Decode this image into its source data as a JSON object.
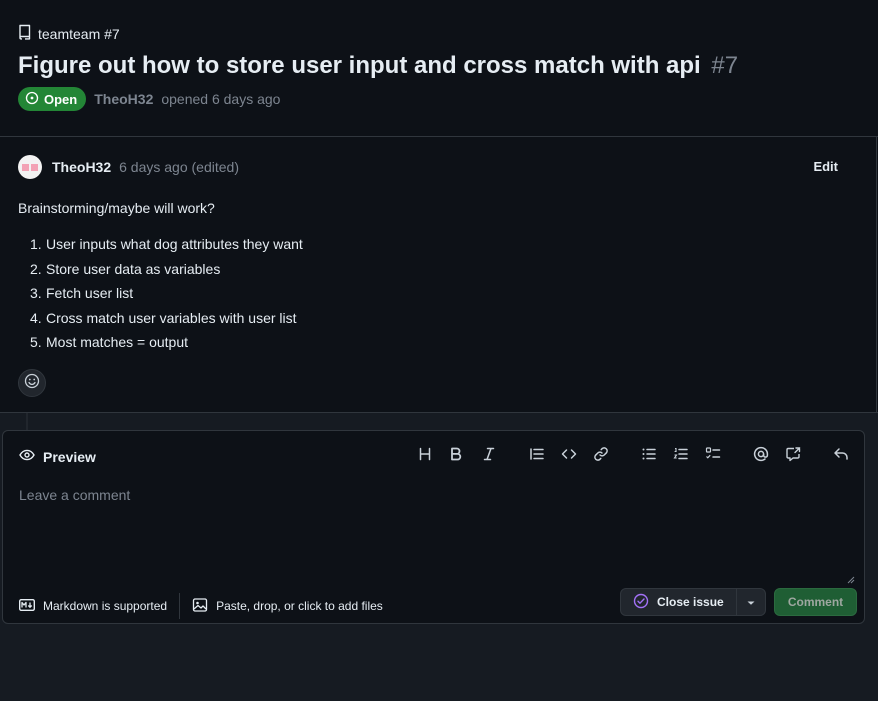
{
  "repo": {
    "label": "teamteam #7",
    "icon": "repo-icon"
  },
  "issue": {
    "title": "Figure out how to store user input and cross match with api",
    "number": "#7",
    "state": "Open",
    "author": "TheoH32",
    "opened_text": "opened 6 days ago"
  },
  "comment": {
    "author": "TheoH32",
    "time": "6 days ago (edited)",
    "edit_label": "Edit",
    "intro": "Brainstorming/maybe will work?",
    "steps": [
      {
        "n": "1.",
        "text": "User inputs what dog attributes they want"
      },
      {
        "n": "2.",
        "text": "Store user data as variables"
      },
      {
        "n": "3.",
        "text": "Fetch user list"
      },
      {
        "n": "4.",
        "text": "Cross match user variables with user list"
      },
      {
        "n": "5.",
        "text": "Most matches = output"
      }
    ]
  },
  "composer": {
    "tab_label": "Preview",
    "placeholder": "Leave a comment",
    "toolbar": [
      "heading-icon",
      "bold-icon",
      "italic-icon",
      "quote-icon",
      "code-icon",
      "link-icon",
      "unordered-list-icon",
      "ordered-list-icon",
      "task-list-icon",
      "mention-icon",
      "cross-reference-icon",
      "reply-icon"
    ],
    "markdown_hint": "Markdown is supported",
    "attach_hint": "Paste, drop, or click to add files",
    "close_label": "Close issue",
    "submit_label": "Comment"
  },
  "colors": {
    "open_green": "#238636",
    "close_purple": "#a371f7",
    "comment_button": "#1f5e34"
  }
}
